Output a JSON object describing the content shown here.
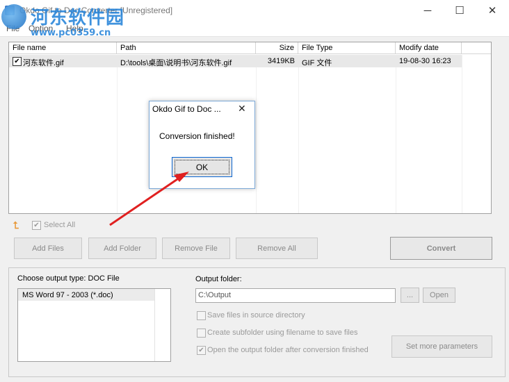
{
  "window": {
    "title": "Okdo Gif to Doc Converter [Unregistered]",
    "minimize": "─",
    "maximize": "☐",
    "close": "✕"
  },
  "watermark": {
    "name": "河东软件园",
    "url": "www.pc0359.cn"
  },
  "menu": [
    "File",
    "Option",
    "Help"
  ],
  "file_list": {
    "columns": [
      "File name",
      "Path",
      "Size",
      "File Type",
      "Modify date"
    ],
    "rows": [
      {
        "checked": true,
        "name": "河东软件.gif",
        "path": "D:\\tools\\桌面\\说明书\\河东软件.gif",
        "size": "3419KB",
        "type": "GIF 文件",
        "date": "19-08-30 16:23"
      }
    ]
  },
  "select_all": {
    "label": "Select All",
    "checked": true
  },
  "buttons": {
    "add_files": "Add Files",
    "add_folder": "Add Folder",
    "remove_file": "Remove File",
    "remove_all": "Remove All",
    "convert": "Convert"
  },
  "output": {
    "type_label": "Choose output type:  DOC File",
    "types": [
      "MS Word 97 - 2003 (*.doc)"
    ],
    "folder_label": "Output folder:",
    "folder_value": "C:\\Output",
    "browse": "...",
    "open": "Open",
    "options": [
      {
        "label": "Save files in source directory",
        "checked": false
      },
      {
        "label": "Create subfolder using filename to save files",
        "checked": false
      },
      {
        "label": "Open the output folder after conversion finished",
        "checked": true
      }
    ],
    "more_params": "Set more parameters"
  },
  "dialog": {
    "title": "Okdo Gif to Doc ...",
    "close": "✕",
    "message": "Conversion finished!",
    "ok": "OK"
  },
  "colors": {
    "arrow": "#e02020",
    "dialog_border": "#7aa7d6",
    "ok_focus": "#0a64cf"
  }
}
